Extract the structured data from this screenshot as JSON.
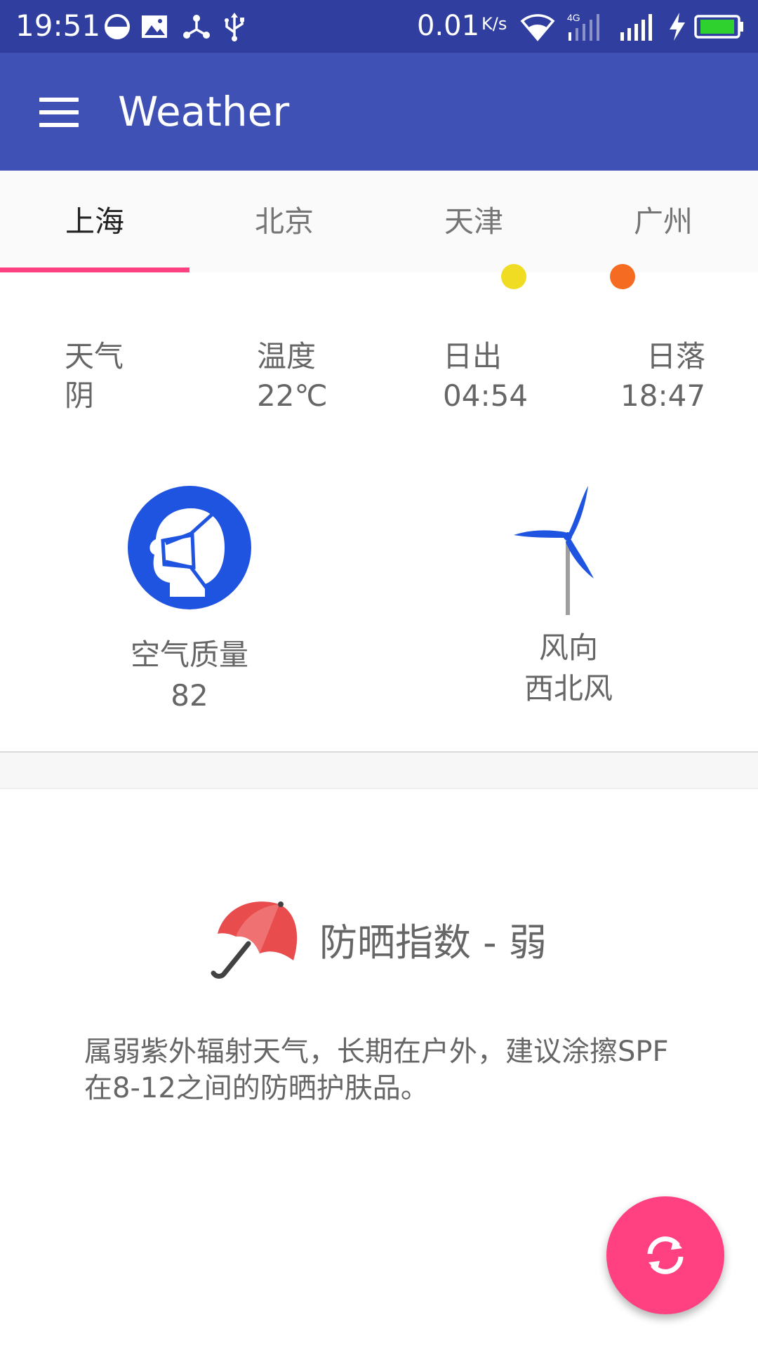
{
  "status_bar": {
    "time": "19:51",
    "speed": "0.01",
    "speed_unit": "K/s",
    "network_label": "4G",
    "icons": [
      "data-saver-icon",
      "image-icon",
      "usb-tether-icon",
      "usb-icon",
      "wifi-icon",
      "signal-4g-icon",
      "signal-icon",
      "charging-icon",
      "battery-icon"
    ]
  },
  "app_bar": {
    "title": "Weather",
    "menu_icon": "hamburger-menu-icon"
  },
  "tabs": [
    {
      "label": "上海",
      "active": true
    },
    {
      "label": "北京",
      "active": false
    },
    {
      "label": "天津",
      "active": false
    },
    {
      "label": "广州",
      "active": false
    }
  ],
  "indicator_dots": [
    "#f1dc24",
    "#f66b22"
  ],
  "info": {
    "weather_label": "天气",
    "weather_value": "阴",
    "temp_label": "温度",
    "temp_value": "22℃",
    "sunrise_label": "日出",
    "sunrise_value": "04:54",
    "sunset_label": "日落",
    "sunset_value": "18:47"
  },
  "air": {
    "icon": "face-mask-icon",
    "label": "空气质量",
    "value": "82"
  },
  "wind": {
    "icon": "wind-turbine-icon",
    "label": "风向",
    "value": "西北风"
  },
  "sunscreen": {
    "icon": "umbrella-icon",
    "title": "防晒指数 - 弱",
    "description": "属弱紫外辐射天气，长期在户外，建议涂擦SPF在8-12之间的防晒护肤品。"
  },
  "fab": {
    "icon": "refresh-icon"
  },
  "colors": {
    "status_bar": "#303f9f",
    "primary": "#3f51b5",
    "accent": "#ff4081",
    "icon_blue": "#1f54e0",
    "umbrella_red": "#e84c4d"
  }
}
